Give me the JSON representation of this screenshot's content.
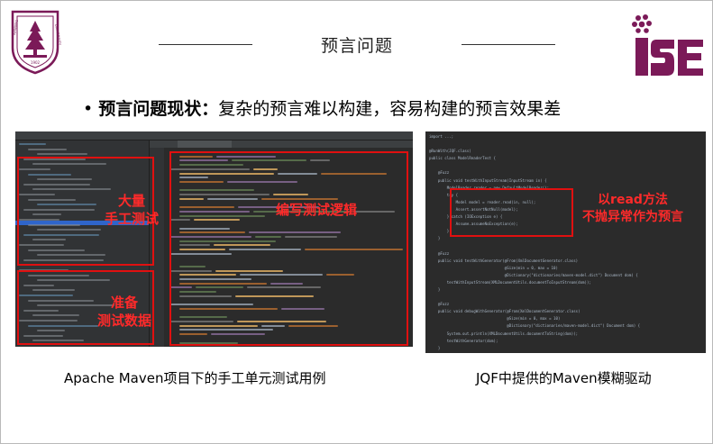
{
  "slide": {
    "title": "预言问题",
    "bullet_marker": "•",
    "bullet_bold": "预言问题现状：",
    "bullet_text": "复杂的预言难以构建，容易构建的预言效果差"
  },
  "logos": {
    "left_name": "NANJING UNIVERSITY",
    "right_name": "ISE"
  },
  "left_panel": {
    "caption": "Apache Maven项目下的手工单元测试用例",
    "annotations": {
      "manual_top": "大量\n手工测试",
      "manual_bottom": "准备\n测试数据",
      "logic": "编写测试逻辑"
    },
    "colors": {
      "bg": "#2b2b2b",
      "accent": "#e01010"
    }
  },
  "right_panel": {
    "caption": "JQF中提供的Maven模糊驱动",
    "annotation": "以read方法\n不抛异常作为预言",
    "code": [
      "import ...;",
      "",
      "@RunWith(JQF.class)",
      "public class ModelReaderTest {",
      "",
      "    @Fuzz",
      "    public void testWithInputStream(InputStream in) {",
      "        ModelReader reader = new DefaultModelReader();",
      "        try {",
      "            Model model = reader.read(in, null);",
      "            Assert.assertNotNull(model);",
      "        } catch (IOException e) {",
      "            Assume.assumeNoException(e);",
      "        }",
      "    }",
      "",
      "    @Fuzz",
      "    public void testWithGenerator(@From(XmlDocumentGenerator.class)",
      "                                  @Size(min = 0, max = 10)",
      "                                  @Dictionary(\"dictionaries/maven-model.dict\") Document dom) {",
      "        testWithInputStream(XMLDocumentUtils.documentToInputStream(dom));",
      "    }",
      "",
      "    @Fuzz",
      "    public void debugWithGenerator(@From(XmlDocumentGenerator.class)",
      "                                   @Size(min = 0, max = 10)",
      "                                   @Dictionary(\"dictionaries/maven-model.dict\") Document dom) {",
      "        System.out.println(XMLDocumentUtils.documentToString(dom));",
      "        testWithGenerator(dom);",
      "    }"
    ]
  }
}
